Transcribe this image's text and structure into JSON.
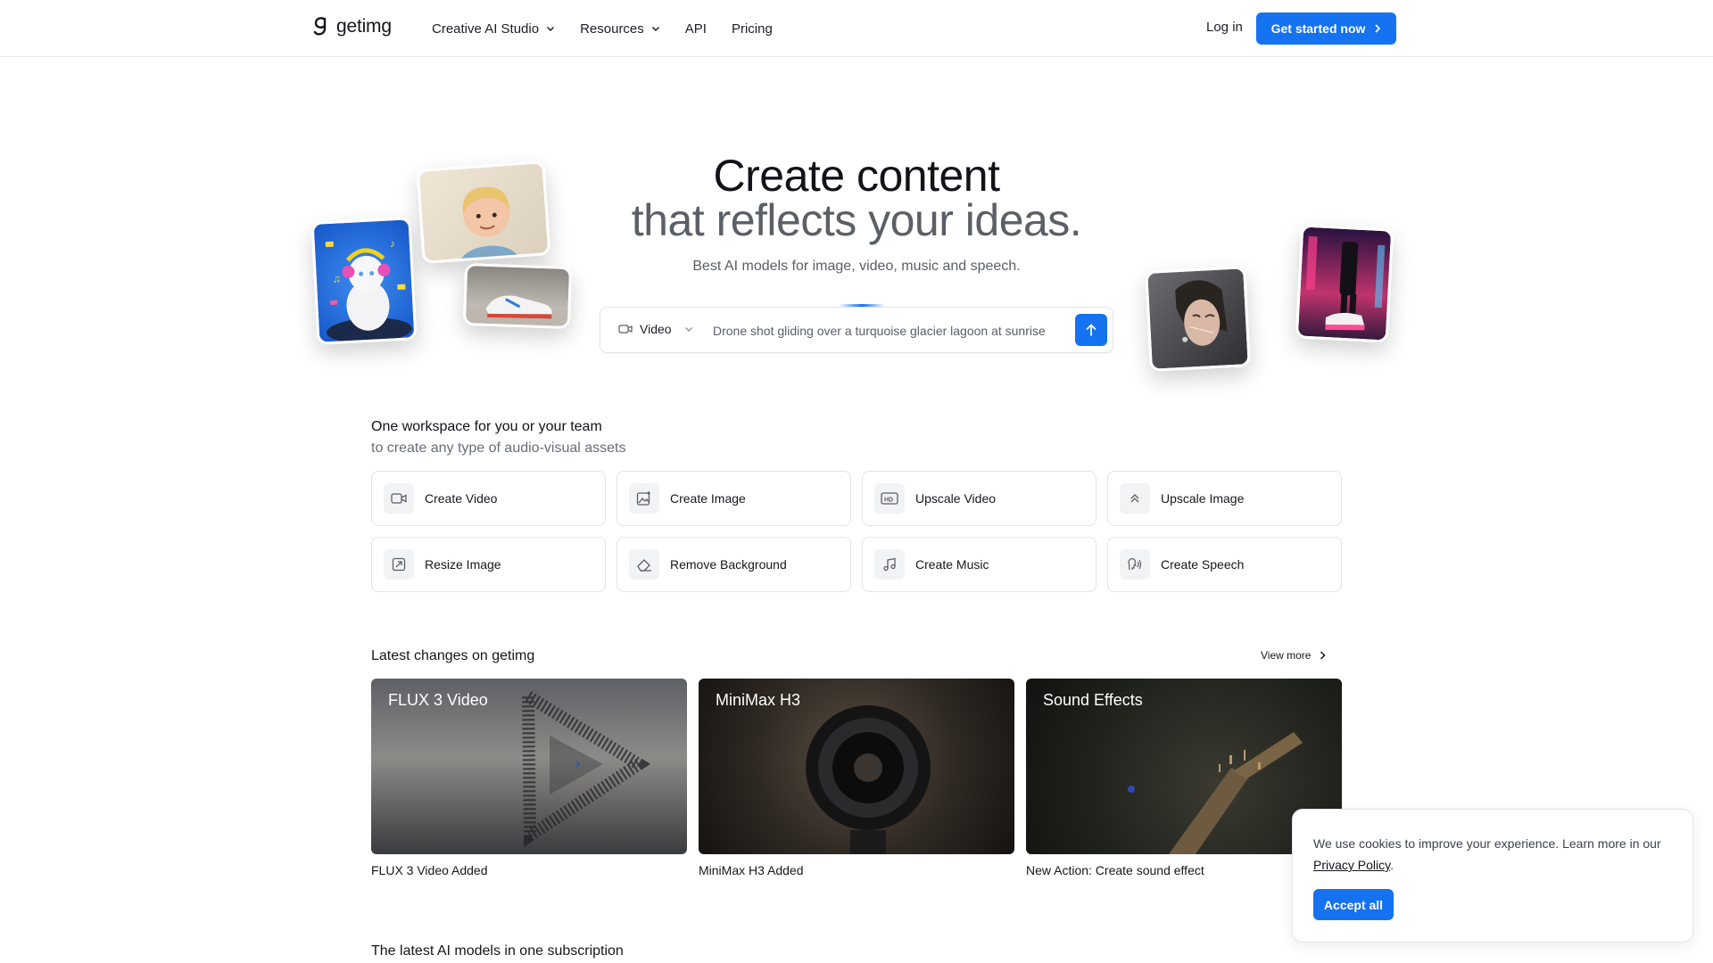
{
  "header": {
    "logo_text": "getimg",
    "nav": [
      {
        "label": "Creative AI Studio",
        "dropdown": true
      },
      {
        "label": "Resources",
        "dropdown": true
      },
      {
        "label": "API",
        "dropdown": false
      },
      {
        "label": "Pricing",
        "dropdown": false
      }
    ],
    "login_label": "Log in",
    "cta_label": "Get started now"
  },
  "hero": {
    "title_line1": "Create content",
    "title_line2": "that reflects your ideas.",
    "subtitle": "Best AI models for image, video, music and speech.",
    "prompt": {
      "mode_label": "Video",
      "text": "Drone shot gliding over a turquoise glacier lagoon at sunrise",
      "submit_icon": "arrow-up-icon"
    }
  },
  "workspace": {
    "title": "One workspace for you or your team",
    "subtitle": "to create any type of audio-visual assets",
    "tools": [
      {
        "label": "Create Video",
        "icon": "video-camera-icon"
      },
      {
        "label": "Create Image",
        "icon": "image-sparkle-icon"
      },
      {
        "label": "Upscale Video",
        "icon": "hd-icon"
      },
      {
        "label": "Upscale Image",
        "icon": "chevrons-up-icon"
      },
      {
        "label": "Resize Image",
        "icon": "resize-icon"
      },
      {
        "label": "Remove Background",
        "icon": "eraser-icon"
      },
      {
        "label": "Create Music",
        "icon": "music-note-icon"
      },
      {
        "label": "Create Speech",
        "icon": "speech-icon"
      }
    ]
  },
  "latest": {
    "title": "Latest changes on getimg",
    "view_more": "View more",
    "items": [
      {
        "title": "FLUX 3 Video",
        "caption": "FLUX 3 Video Added"
      },
      {
        "title": "MiniMax H3",
        "caption": "MiniMax H3 Added"
      },
      {
        "title": "Sound Effects",
        "caption": "New Action: Create sound effect"
      }
    ]
  },
  "models_section": {
    "title": "The latest AI models in one subscription"
  },
  "cookie": {
    "text": "We use cookies to improve your experience. Learn more in our",
    "link": "Privacy Policy",
    "suffix": ".",
    "accept_label": "Accept all"
  },
  "colors": {
    "accent": "#1572f0",
    "text": "#111318",
    "muted": "#5b5f66",
    "border": "#e3e4e8"
  }
}
